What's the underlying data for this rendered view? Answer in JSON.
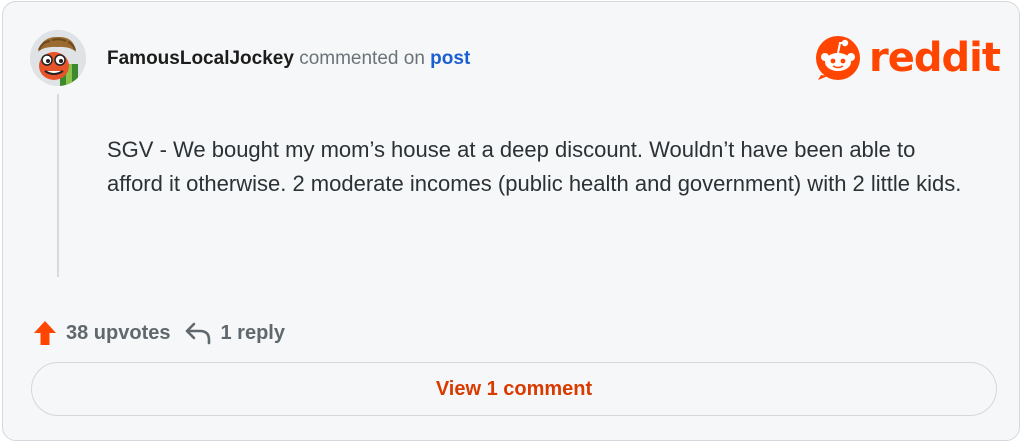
{
  "comment": {
    "username": "FamousLocalJockey",
    "action_text": "commented on",
    "post_link_text": "post",
    "body": "SGV - We bought my mom’s house at a deep discount. Wouldn’t have been able to afford it otherwise. 2 moderate incomes (public health and government) with 2 little kids."
  },
  "logo": {
    "wordmark": "reddit",
    "icon": "reddit-snoo-icon"
  },
  "stats": {
    "upvotes": "38 upvotes",
    "replies": "1 reply",
    "upvote_icon": "upvote-arrow-icon",
    "reply_icon": "reply-arrow-icon"
  },
  "view_button": {
    "label": "View 1 comment"
  },
  "colors": {
    "brand": "#ff4500",
    "link": "#1a5fd0",
    "button_text": "#d93a00",
    "card_background": "#f6f7f8",
    "border": "#d4d8dc"
  }
}
